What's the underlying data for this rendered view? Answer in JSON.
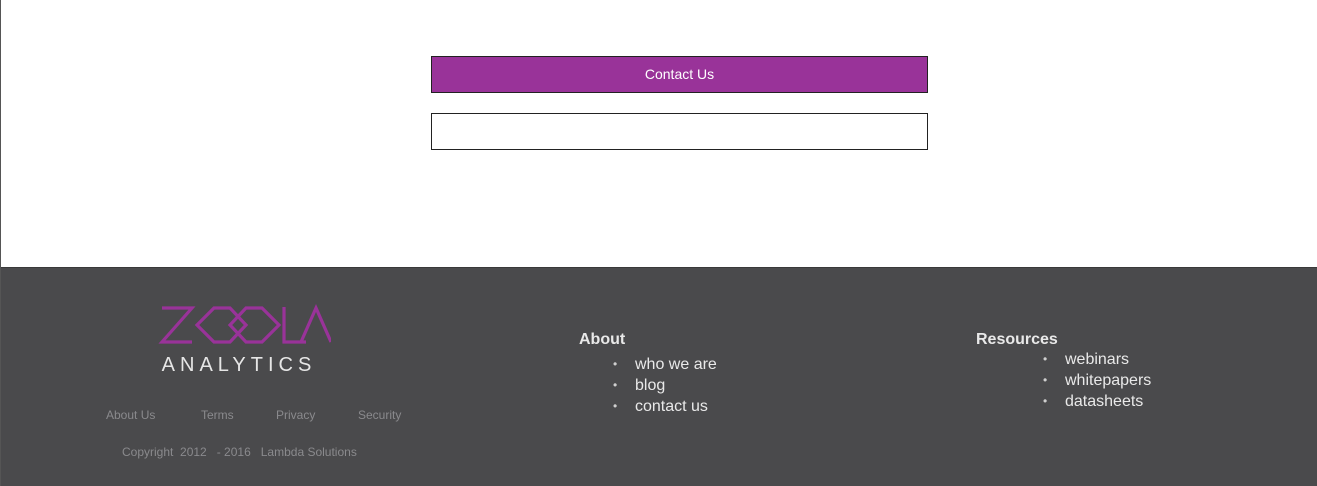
{
  "main": {
    "contact_button_label": "Contact Us",
    "contact_input_value": "",
    "contact_input_placeholder": ""
  },
  "footer": {
    "logo": {
      "wordmark": "ZOOLA",
      "subtitle": "ANALYTICS",
      "colors": {
        "wordmark": "#993399",
        "subtitle": "#e6e6e6"
      }
    },
    "legal_links": [
      "About Us",
      "Terms",
      "Privacy",
      "Security"
    ],
    "copyright": "Copyright  2012   - 2016   Lambda Solutions",
    "about": {
      "heading": "About",
      "items": [
        "who we are",
        "blog",
        "contact us"
      ]
    },
    "resources": {
      "heading": "Resources",
      "items": [
        "webinars",
        "whitepapers",
        "datasheets"
      ]
    }
  },
  "colors": {
    "accent": "#993399",
    "footer_bg": "#4a4a4c",
    "footer_muted_text": "#8a8a8d",
    "footer_text": "#e9e9e9"
  }
}
